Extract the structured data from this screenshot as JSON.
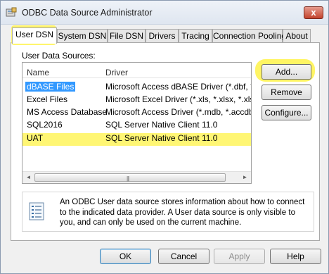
{
  "window": {
    "title": "ODBC Data Source Administrator",
    "close_label": "x"
  },
  "tabs": [
    {
      "label": "User DSN",
      "active": true
    },
    {
      "label": "System DSN",
      "active": false
    },
    {
      "label": "File DSN",
      "active": false
    },
    {
      "label": "Drivers",
      "active": false
    },
    {
      "label": "Tracing",
      "active": false
    },
    {
      "label": "Connection Pooling",
      "active": false
    },
    {
      "label": "About",
      "active": false
    }
  ],
  "panel": {
    "section_label": "User Data Sources:",
    "columns": {
      "name": "Name",
      "driver": "Driver"
    },
    "rows": [
      {
        "name": "dBASE Files",
        "driver": "Microsoft Access dBASE Driver (*.dbf, *.ndx",
        "selected": true
      },
      {
        "name": "Excel Files",
        "driver": "Microsoft Excel Driver (*.xls, *.xlsx, *.xlsm, *.x"
      },
      {
        "name": "MS Access Database",
        "driver": "Microsoft Access Driver (*.mdb, *.accdb)"
      },
      {
        "name": "SQL2016",
        "driver": "SQL Server Native Client 11.0"
      },
      {
        "name": "UAT",
        "driver": "SQL Server Native Client 11.0"
      }
    ],
    "scroll_left": "◄",
    "scroll_right": "►",
    "scroll_grip": "|||",
    "buttons": {
      "add": "Add...",
      "remove": "Remove",
      "configure": "Configure..."
    },
    "info_text": "An ODBC User data source stores information about how to connect to the indicated data provider.   A User data source is only visible to you, and can only be used on the current machine."
  },
  "footer": {
    "ok": "OK",
    "cancel": "Cancel",
    "apply": "Apply",
    "help": "Help"
  },
  "colors": {
    "highlight": "#fff45c",
    "selection": "#3399ff"
  },
  "icons": [
    "odbc-app-icon",
    "close-icon",
    "data-source-info-icon"
  ]
}
